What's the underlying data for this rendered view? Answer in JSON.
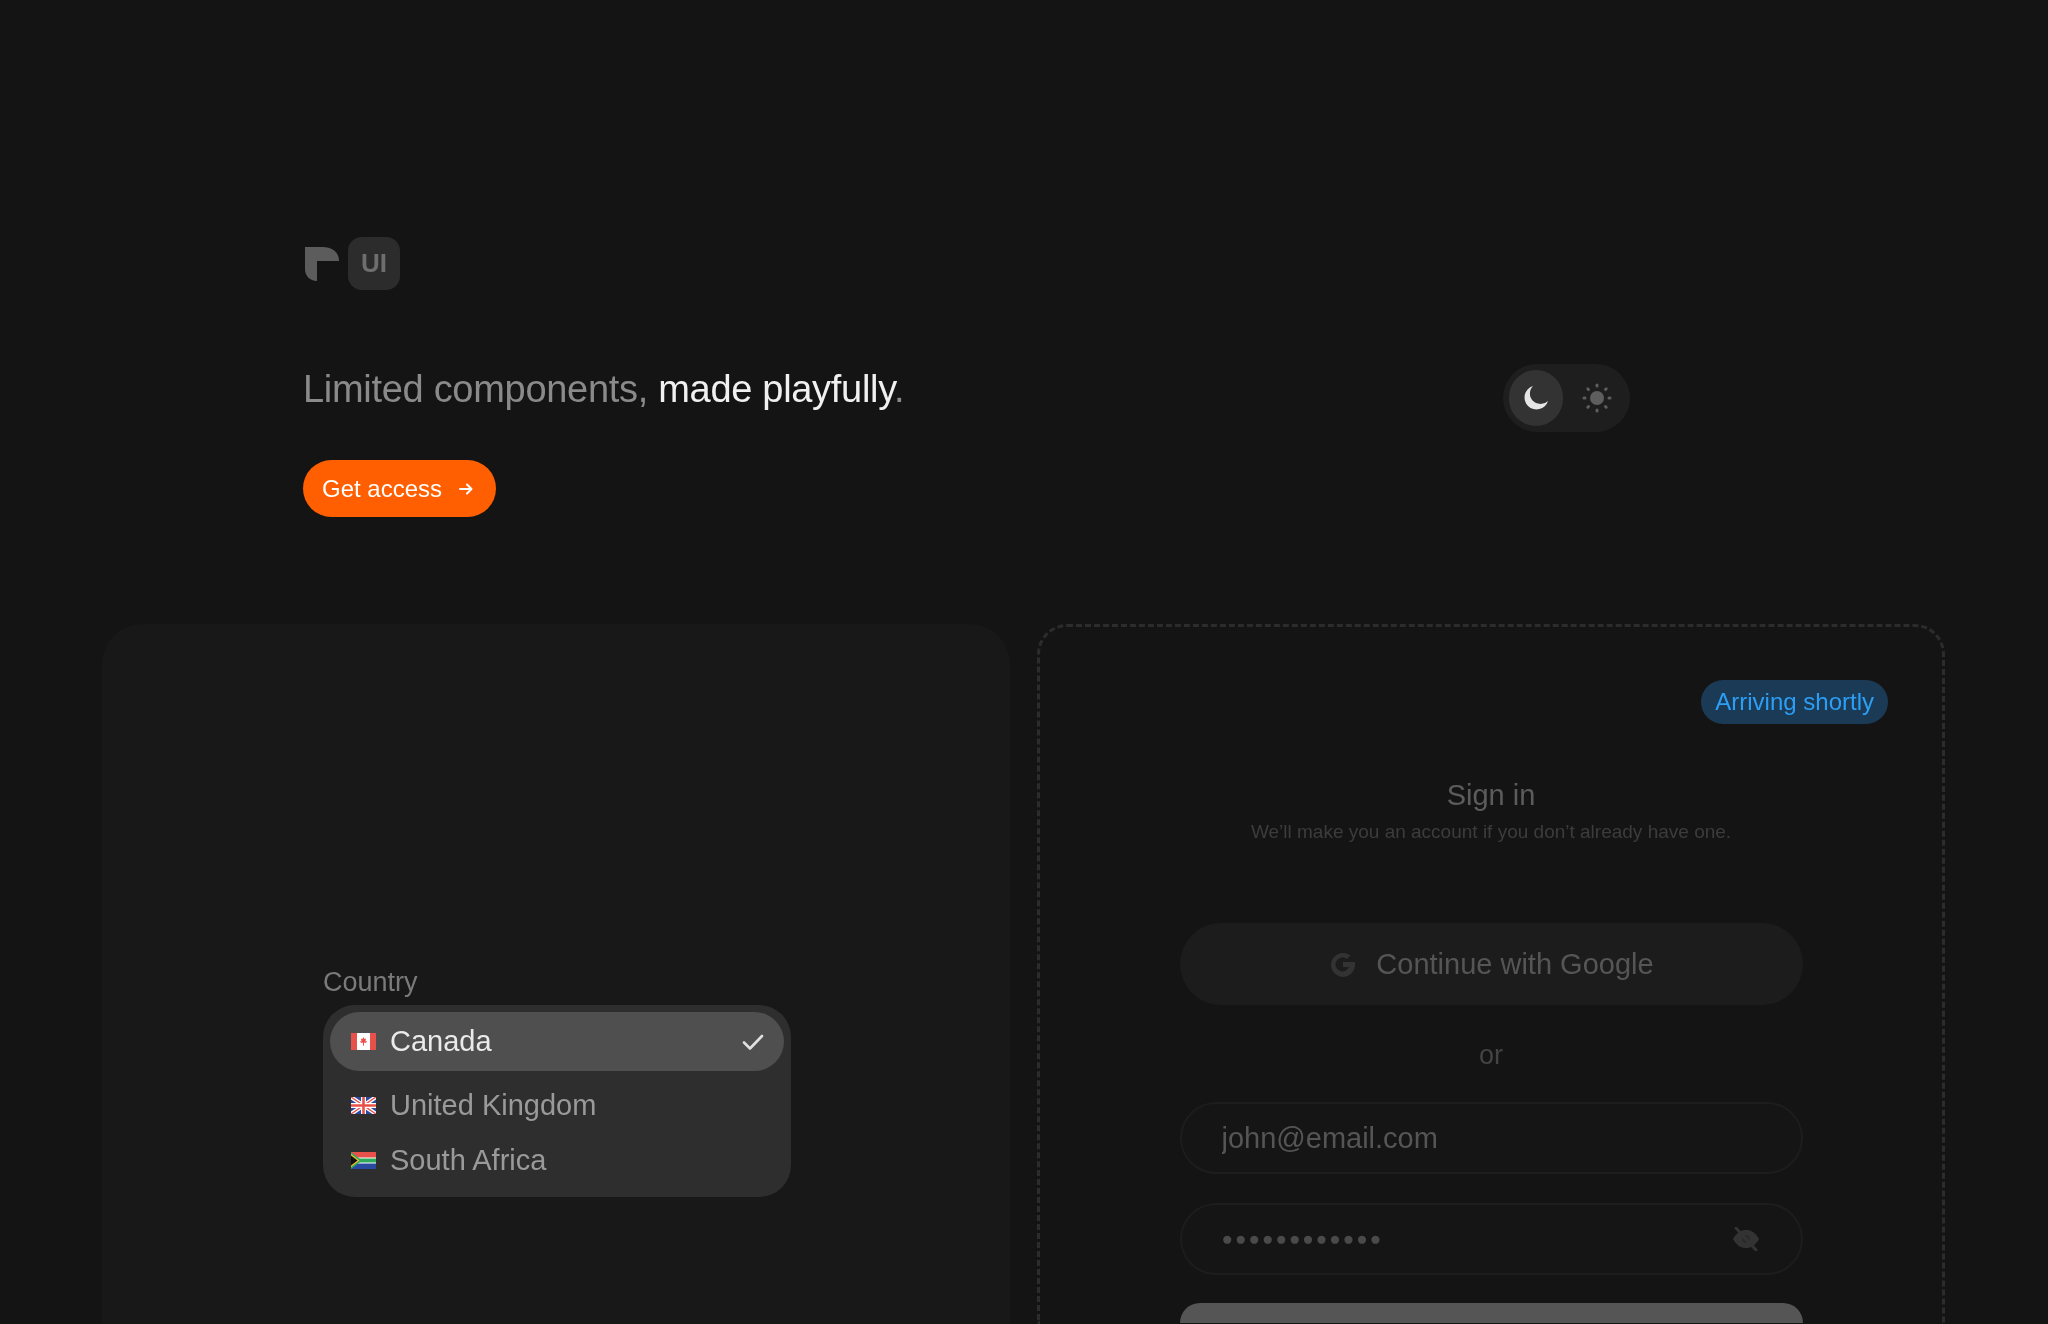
{
  "logo": {
    "badge": "UI"
  },
  "headline": {
    "parts": [
      {
        "text": "Limited components, ",
        "highlight": false
      },
      {
        "text": "made playfully",
        "highlight": true
      },
      {
        "text": ".",
        "highlight": false
      }
    ]
  },
  "cta_button": {
    "label": "Get access"
  },
  "theme_toggle": {
    "options": [
      {
        "kind": "moon",
        "selected": true
      },
      {
        "kind": "sun",
        "selected": false
      }
    ]
  },
  "country_select": {
    "label": "Country",
    "options": [
      {
        "name": "Canada",
        "kind": "ca",
        "selected": true
      },
      {
        "name": "United Kingdom",
        "kind": "gb",
        "selected": false
      },
      {
        "name": "South Africa",
        "kind": "za",
        "selected": false
      }
    ]
  },
  "sign_in": {
    "badge": "Arriving shortly",
    "title": "Sign in",
    "subtitle": "We’ll make you an account if you don’t already have one.",
    "google_button": "Continue with Google",
    "divider": "or",
    "email": {
      "placeholder": "john@email.com"
    },
    "password": {
      "value": "●●●●●●●●●●●●",
      "revealed": false
    }
  }
}
